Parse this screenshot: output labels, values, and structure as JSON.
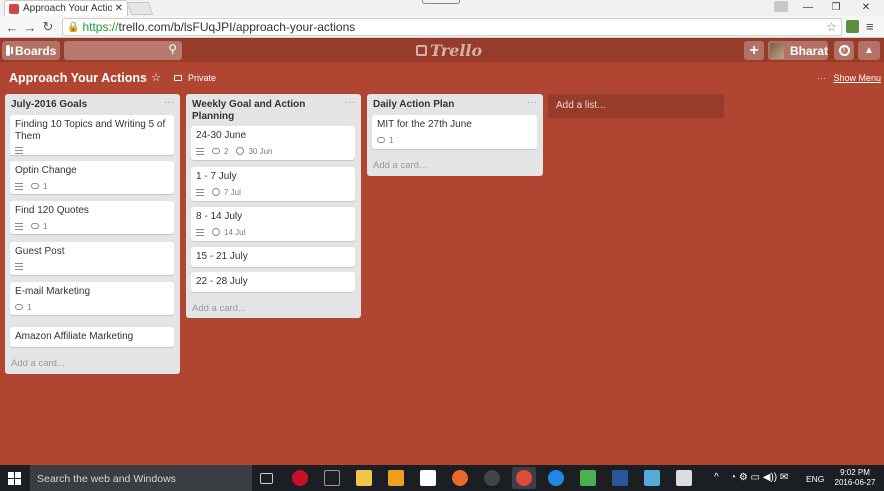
{
  "browser": {
    "tab_title": "Approach Your Actions | T",
    "tab_close": "✕",
    "url_secure": "https://",
    "url_rest": "trello.com/b/lsFUqJPI/approach-your-actions",
    "window_controls": [
      "—",
      "❐",
      "✕"
    ]
  },
  "header": {
    "boards_label": "Boards",
    "logo_text": "Trello",
    "plus_label": "+",
    "user_name": "Bharat",
    "info_label": "!",
    "bell_label": "🔔"
  },
  "board": {
    "title": "Approach Your Actions",
    "star": "☆",
    "visibility": "Private",
    "show_menu_dots": "···",
    "show_menu": "Show Menu"
  },
  "lists": [
    {
      "title": "July-2016 Goals",
      "menu": "···",
      "add_card": "Add a card...",
      "cards": [
        {
          "title": "Finding 10 Topics and Writing 5 of Them",
          "comments": ""
        },
        {
          "title": "Optin Change",
          "comments": "1"
        },
        {
          "title": "Find 120 Quotes",
          "comments": "1"
        },
        {
          "title": "Guest Post",
          "comments": ""
        },
        {
          "title": "E-mail Marketing",
          "comments": "1"
        },
        {
          "title": "Amazon Affiliate Marketing",
          "comments": ""
        }
      ]
    },
    {
      "title": "Weekly Goal and Action Planning",
      "menu": "···",
      "add_card": "Add a card...",
      "cards": [
        {
          "title": "24-30 June",
          "comments": "2",
          "due": "30 Jun"
        },
        {
          "title": "1 - 7 July",
          "due": "7 Jul"
        },
        {
          "title": "8 - 14 July",
          "due": "14 Jul"
        },
        {
          "title": "15 - 21 July"
        },
        {
          "title": "22 - 28 July"
        }
      ]
    },
    {
      "title": "Daily Action Plan",
      "menu": "···",
      "add_card": "Add a card...",
      "cards": [
        {
          "title": "MIT for the 27th June",
          "comments": "1"
        }
      ]
    }
  ],
  "add_list": "Add a list...",
  "taskbar": {
    "search_placeholder": "Search the web and Windows",
    "language": "ENG",
    "time": "9:02 PM",
    "date": "2016-06-27",
    "tray_chevron": "^"
  },
  "colors": {
    "board_bg": "#b04632",
    "header_bg": "#973b2b",
    "list_bg": "#e2e4e6"
  }
}
